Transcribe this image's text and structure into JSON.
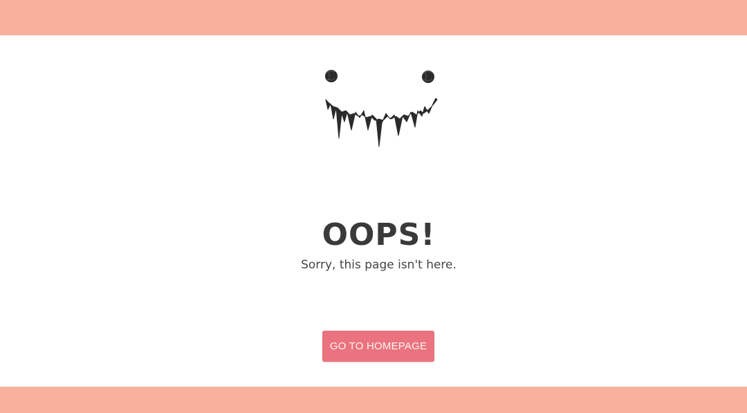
{
  "colors": {
    "band": "#f8b19a",
    "button_bg": "#ea737f",
    "button_text": "#fff7ef",
    "title_text": "#3a3a3a",
    "body_text": "#444444",
    "illustration": "#2b2b2b"
  },
  "illustration": {
    "icon": "monster-face-icon"
  },
  "error": {
    "title": "OOPS!",
    "message": "Sorry, this page isn't here."
  },
  "actions": {
    "home_label": "GO TO HOMEPAGE"
  }
}
